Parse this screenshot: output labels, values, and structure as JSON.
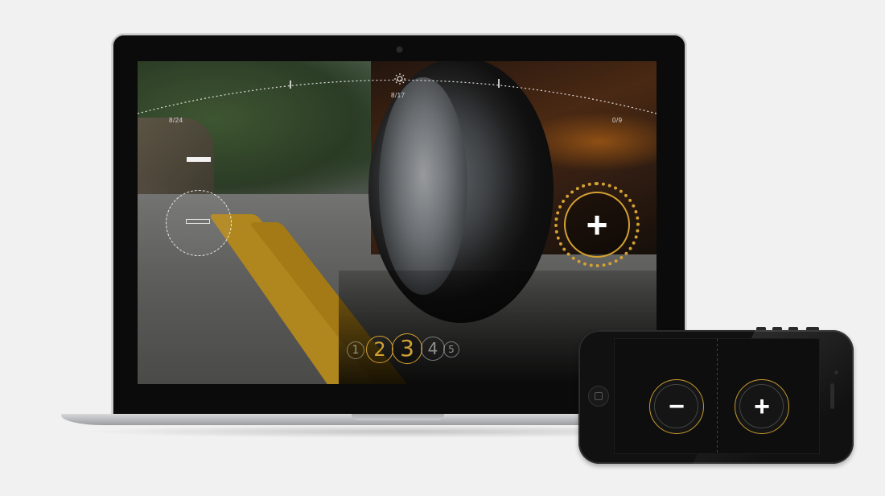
{
  "screen": {
    "hud": {
      "left_counter": "8/24",
      "center_counter": "8/17",
      "right_counter": "0/9",
      "brightness_icon": "sun-icon"
    },
    "gears": [
      "1",
      "2",
      "3",
      "4",
      "5"
    ],
    "selected_gear": "3",
    "minus_symbol": "−",
    "plus_symbol": "+"
  },
  "phone": {
    "minus_symbol": "−",
    "plus_symbol": "+",
    "home_icon": "home-button-icon"
  },
  "colors": {
    "accent_gold": "#d3a132",
    "hud_white": "#ffffff",
    "background": "#f1f1f1"
  }
}
